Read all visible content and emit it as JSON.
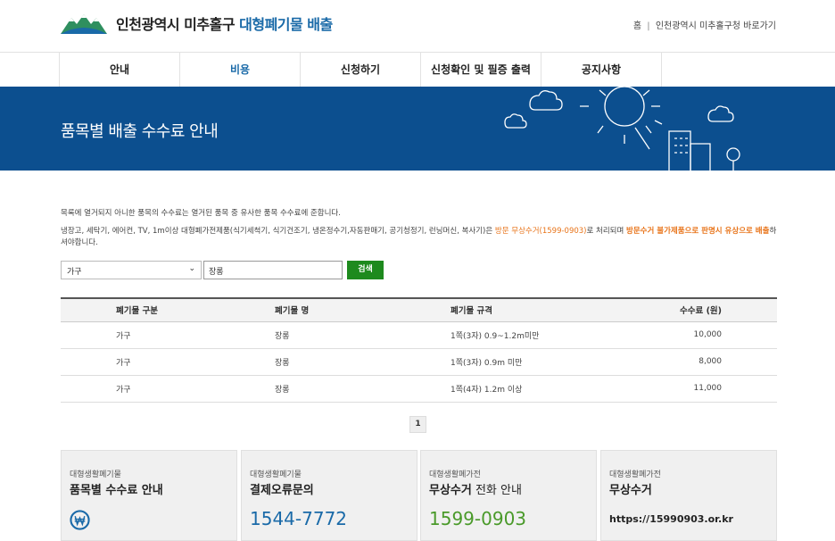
{
  "header": {
    "brand_main": "인천광역시 미추홀구",
    "brand_accent": "대형폐기물 배출",
    "links": [
      "홈",
      "인천광역시 미추홀구청 바로가기"
    ],
    "link_sep": "|"
  },
  "nav": {
    "items": [
      "안내",
      "비용",
      "신청하기",
      "신청확인 및 필증 출력",
      "공지사항"
    ],
    "active_index": 1
  },
  "banner": {
    "title": "품목별 배출 수수료 안내"
  },
  "notice": {
    "line1": "목록에 열거되지 아니한 품목의 수수료는 열거된 품목 중 유사한 품목 수수료에 준합니다.",
    "line2_part1": "냉장고, 세탁기, 에어컨, TV, 1m이상 대형폐가전제품(식기세척기, 식기건조기, 냉온정수기,자동판매기, 공기청정기, 런닝머신, 복사기)은 ",
    "line2_orange": "방문 무상수거(1599-0903)",
    "line2_part2": "로 처리되며 ",
    "line2_orange_bold": "방문수거 불가제품으로 판명시 유상으로 배출",
    "line2_part3": "하셔야합니다."
  },
  "search": {
    "category_selected": "가구",
    "keyword_value": "장롱",
    "button_label": "검색"
  },
  "table": {
    "headers": [
      "폐기물 구분",
      "폐기물 명",
      "폐기물 규격",
      "수수료 (원)"
    ],
    "rows": [
      [
        "가구",
        "장롱",
        "1쪽(3자) 0.9~1.2m미만",
        "10,000"
      ],
      [
        "가구",
        "장롱",
        "1쪽(3자) 0.9m 미만",
        "8,000"
      ],
      [
        "가구",
        "장롱",
        "1쪽(4자) 1.2m 이상",
        "11,000"
      ]
    ]
  },
  "pagination": {
    "current": "1"
  },
  "cards": [
    {
      "small": "대형생활폐기물",
      "title": "품목별 수수료 안내",
      "icon": "won-icon"
    },
    {
      "small": "대형생활폐기물",
      "title": "결제오류문의",
      "value": "1544-7772"
    },
    {
      "small": "대형생활폐가전",
      "title_bold": "무상수거",
      "title_normal": " 전화 안내",
      "value": "1599-0903"
    },
    {
      "small": "대형생활폐가전",
      "title": "무상수거",
      "url": "https://15990903.or.kr"
    }
  ],
  "colors": {
    "brand_blue": "#1a6aa8",
    "banner_bg": "#0c4f8f",
    "search_button": "#1e8a1e",
    "orange": "#e8741a",
    "green_number": "#4a9a2a"
  }
}
